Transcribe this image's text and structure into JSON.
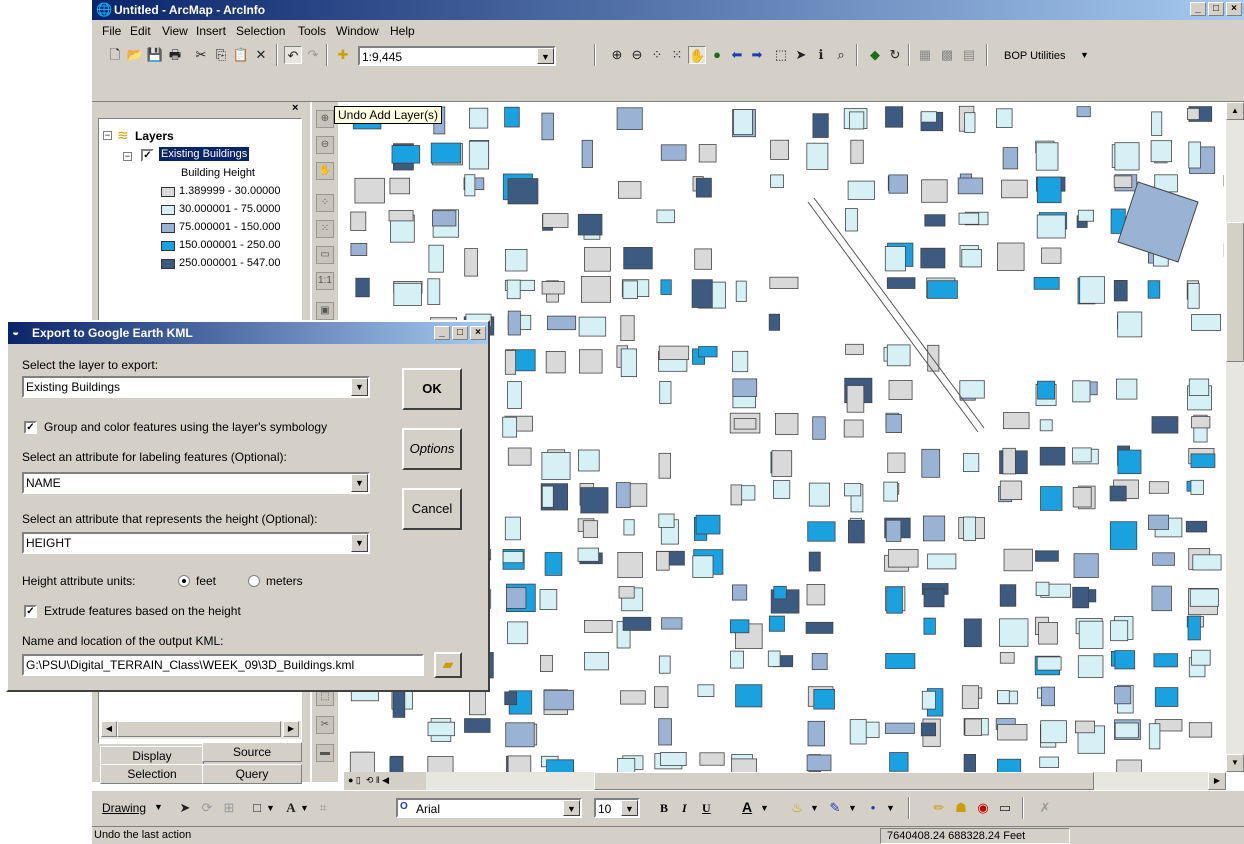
{
  "window": {
    "title": "Untitled - ArcMap - ArcInfo"
  },
  "menu": [
    "File",
    "Edit",
    "View",
    "Insert",
    "Selection",
    "Tools",
    "Window",
    "Help"
  ],
  "toolbar": {
    "scale": "1:9,445",
    "bop_utilities": "BOP Utilities"
  },
  "tooltip": "Undo Add Layer(s)",
  "toc": {
    "root": "Layers",
    "layer": "Existing Buildings",
    "field": "Building Height",
    "classes": [
      {
        "label": "1.389999 - 30.00000",
        "color": "#d9d9d9"
      },
      {
        "label": "30.000001 - 75.0000",
        "color": "#d6f1f5"
      },
      {
        "label": "75.000001 - 150.000",
        "color": "#9ab3d5"
      },
      {
        "label": "150.000001 - 250.00",
        "color": "#1aa1e0"
      },
      {
        "label": "250.000001 - 547.00",
        "color": "#3d5a80"
      }
    ],
    "tabs": {
      "display": "Display",
      "source": "Source",
      "selection": "Selection",
      "query": "Query"
    }
  },
  "dialog": {
    "title": "Export to Google Earth KML",
    "layer_label": "Select the layer to export:",
    "layer_value": "Existing Buildings",
    "group_label": "Group and color features using the layer's symbology",
    "label_attr_label": "Select an attribute for labeling features (Optional):",
    "label_attr_value": "NAME",
    "height_attr_label": "Select an attribute that represents the height (Optional):",
    "height_attr_value": "HEIGHT",
    "units_label": "Height attribute units:",
    "units_feet": "feet",
    "units_meters": "meters",
    "extrude_label": "Extrude features based on the height",
    "output_label": "Name and location of the output KML:",
    "output_value": "G:\\PSU\\Digital_TERRAIN_Class\\WEEK_09\\3D_Buildings.kml",
    "ok": "OK",
    "options": "Options",
    "cancel": "Cancel"
  },
  "drawbar": {
    "drawing": "Drawing",
    "font": "Arial",
    "size": "10",
    "bold": "B",
    "italic": "I",
    "underline": "U",
    "font_color": "A"
  },
  "status": {
    "message": "Undo the last action",
    "coords": "7640408.24  688328.24 Feet"
  },
  "colors": {
    "c1": "#d9d9d9",
    "c2": "#d6f1f5",
    "c3": "#9ab3d5",
    "c4": "#1aa1e0",
    "c5": "#3d5a80"
  }
}
